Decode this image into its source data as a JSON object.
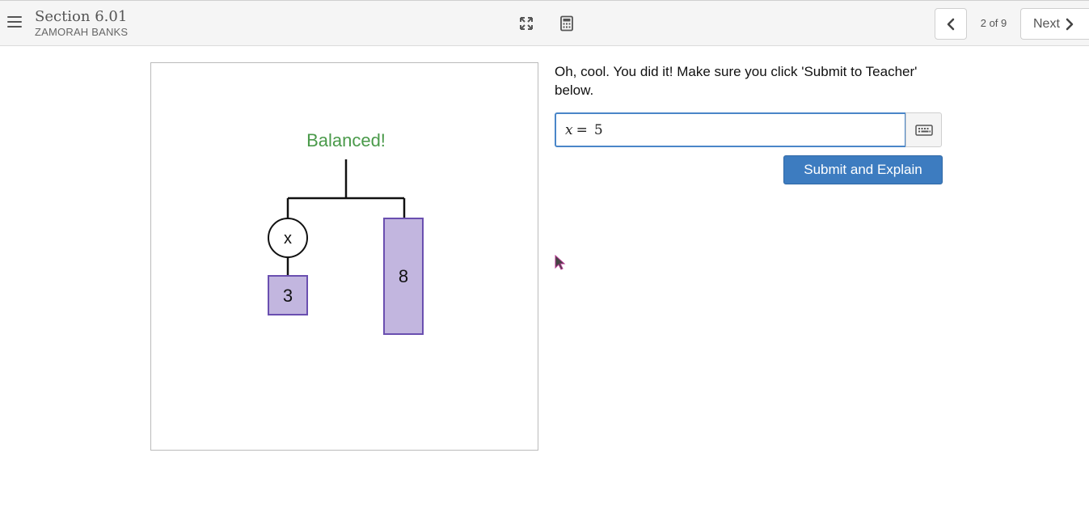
{
  "header": {
    "section_title": "Section 6.01",
    "student_name": "ZAMORAH BANKS",
    "page_indicator": "2 of 9",
    "next_label": "Next",
    "icons": {
      "menu": "hamburger-menu-icon",
      "expand": "expand-icon",
      "calculator": "calculator-icon",
      "prev": "chevron-left-icon",
      "next": "chevron-right-icon"
    }
  },
  "graph": {
    "status_text": "Balanced!",
    "left_variable": "x",
    "left_block_value": "3",
    "right_block_value": "8",
    "colors": {
      "status": "#4a9a4a",
      "block_fill": "#c2b6df",
      "block_stroke": "#6a4fb0"
    }
  },
  "question": {
    "prompt": "Oh, cool. You did it! Make sure you click 'Submit to Teacher' below.",
    "answer_variable": "x",
    "answer_equals": "=",
    "answer_value": "5",
    "keyboard_icon": "keyboard-icon",
    "submit_label": "Submit and Explain"
  },
  "accent": "#3d7cc0"
}
